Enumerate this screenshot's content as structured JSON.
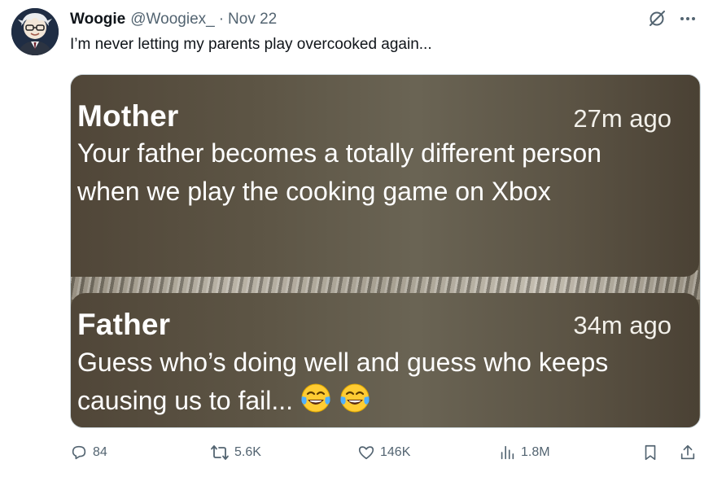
{
  "author": {
    "name": "Woogie",
    "handle": "@Woogiex_",
    "separator": "·",
    "date": "Nov 22"
  },
  "post": {
    "text": "I’m never letting my parents play overcooked again..."
  },
  "header_icons": [
    "grok-icon",
    "more-icon"
  ],
  "media": {
    "messages": [
      {
        "sender": "Mother",
        "time": "27m ago",
        "text": "Your father becomes a totally different person when we play the cooking game on Xbox"
      },
      {
        "sender": "Father",
        "time": "34m ago",
        "text": "Guess who’s doing well and guess who keeps causing us to fail...",
        "emoji": [
          "face-with-tears-of-joy",
          "face-with-tears-of-joy"
        ]
      }
    ]
  },
  "actions": {
    "replies": "84",
    "reposts": "5.6K",
    "likes": "146K",
    "views": "1.8M"
  },
  "colors": {
    "text_primary": "#0f1419",
    "text_secondary": "#536471",
    "bubble_background": "#5d5545"
  }
}
